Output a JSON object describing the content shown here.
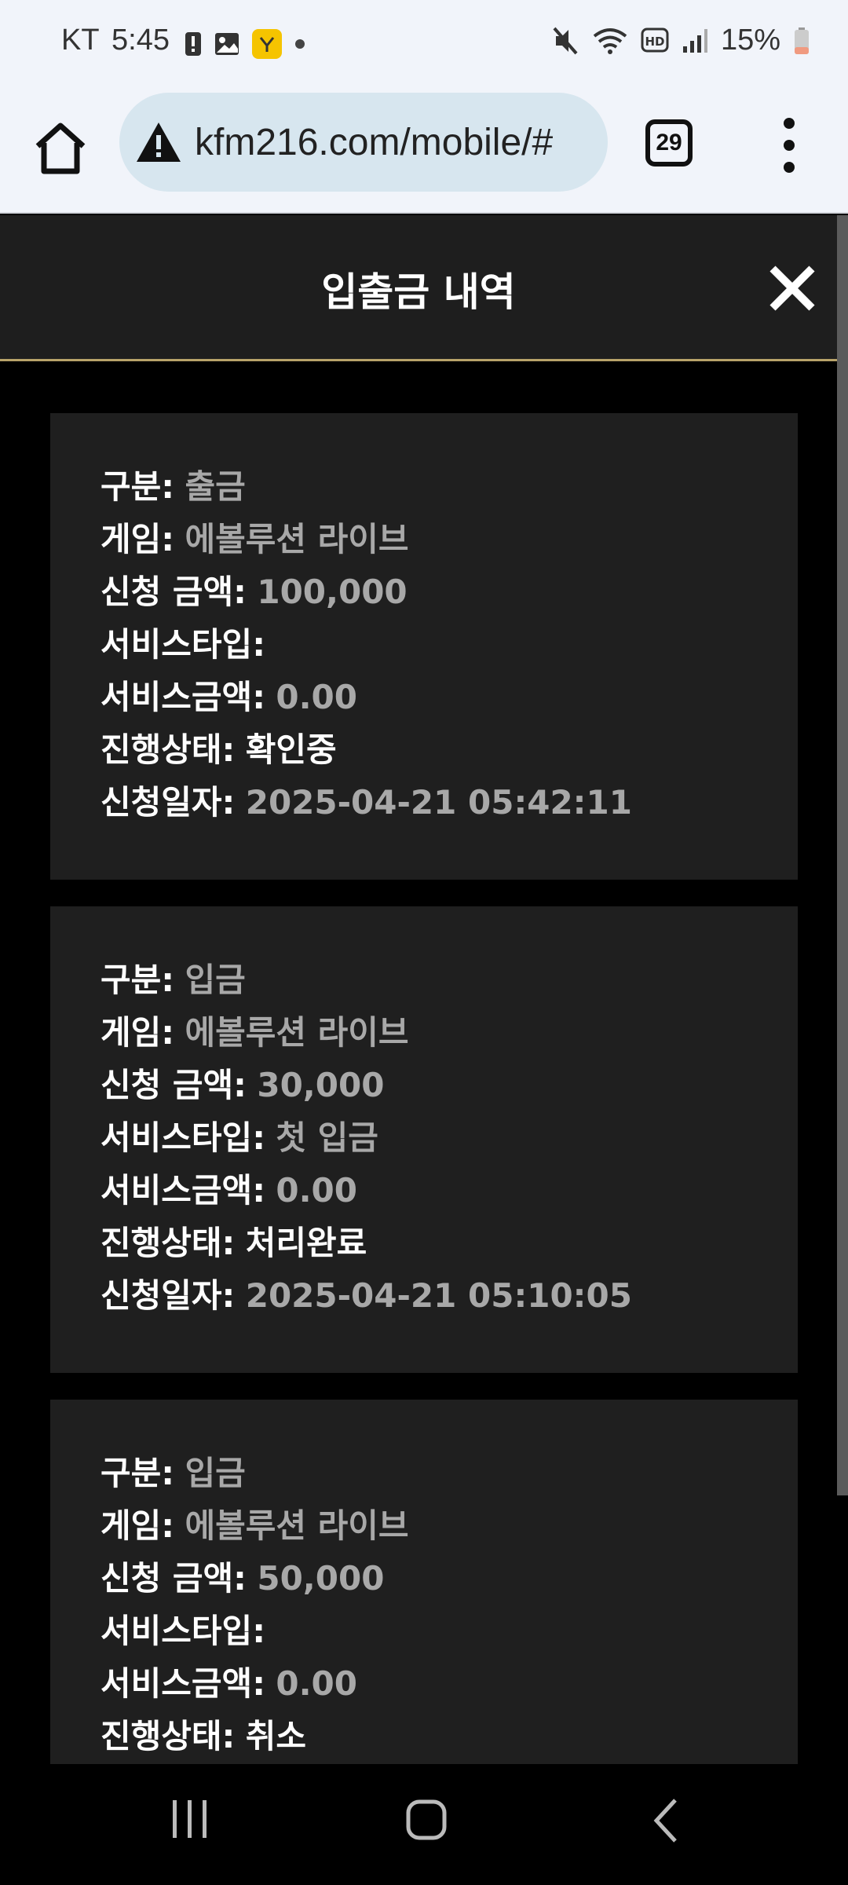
{
  "status": {
    "carrier": "KT",
    "time": "5:45",
    "battery": "15%"
  },
  "browser": {
    "url": "kfm216.com/mobile/#",
    "tab_count": "29"
  },
  "modal": {
    "title": "입출금 내역"
  },
  "labels": {
    "type": "구분:",
    "game": "게임:",
    "amount": "신청 금액:",
    "service_type": "서비스타입:",
    "service_amount": "서비스금액:",
    "status": "진행상태:",
    "date": "신청일자:"
  },
  "records": [
    {
      "type": "출금",
      "game": "에볼루션 라이브",
      "amount": "100,000",
      "service_type": "",
      "service_amount": "0.00",
      "status": "확인중",
      "date": "2025-04-21 05:42:11"
    },
    {
      "type": "입금",
      "game": "에볼루션 라이브",
      "amount": "30,000",
      "service_type": "첫 입금",
      "service_amount": "0.00",
      "status": "처리완료",
      "date": "2025-04-21 05:10:05"
    },
    {
      "type": "입금",
      "game": "에볼루션 라이브",
      "amount": "50,000",
      "service_type": "",
      "service_amount": "0.00",
      "status": "취소"
    }
  ]
}
